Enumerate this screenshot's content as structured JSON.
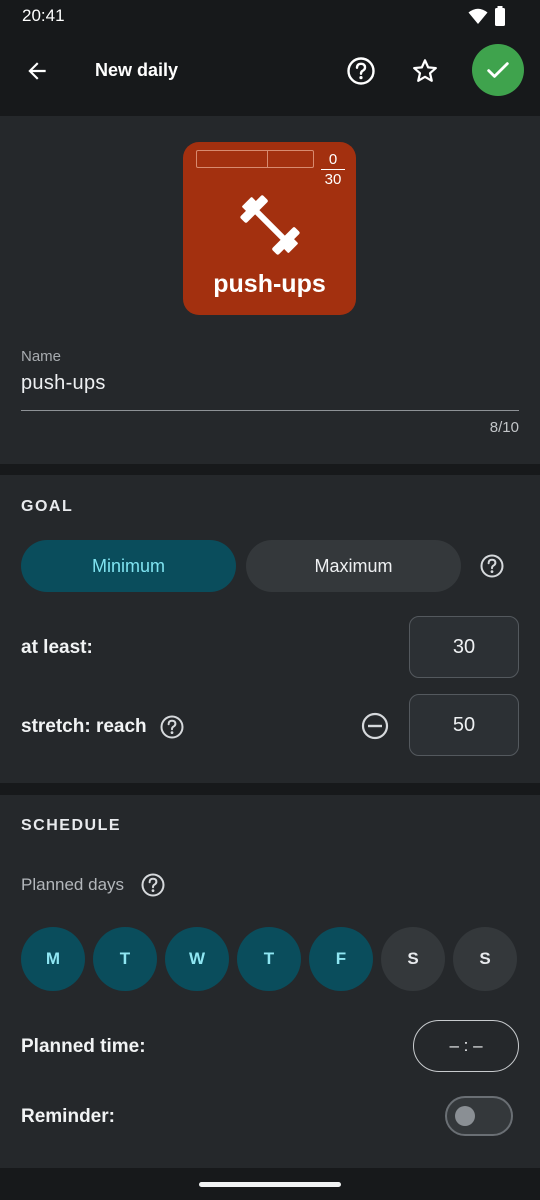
{
  "status": {
    "time": "20:41"
  },
  "appbar": {
    "title": "New daily"
  },
  "card": {
    "count": "0",
    "total": "30",
    "name": "push-ups",
    "color": "#a3300f"
  },
  "name_field": {
    "label": "Name",
    "value": "push-ups",
    "counter": "8/10"
  },
  "goal": {
    "title": "GOAL",
    "options": [
      "Minimum",
      "Maximum"
    ],
    "selected": "Minimum",
    "at_least_label": "at least:",
    "at_least_value": "30",
    "stretch_label": "stretch: reach",
    "stretch_value": "50"
  },
  "schedule": {
    "title": "SCHEDULE",
    "planned_days_label": "Planned days",
    "days": [
      {
        "label": "M",
        "selected": true
      },
      {
        "label": "T",
        "selected": true
      },
      {
        "label": "W",
        "selected": true
      },
      {
        "label": "T",
        "selected": true
      },
      {
        "label": "F",
        "selected": true
      },
      {
        "label": "S",
        "selected": false
      },
      {
        "label": "S",
        "selected": false
      }
    ],
    "planned_time_label": "Planned time:",
    "planned_time_value": "– : –",
    "reminder_label": "Reminder:",
    "reminder_on": false
  },
  "colors": {
    "accent": "#0a4d5c",
    "accent_text": "#7fe3f0",
    "confirm": "#3fa34d"
  },
  "icons": [
    "wifi-icon",
    "battery-icon",
    "back-arrow-icon",
    "help-icon",
    "star-icon",
    "check-icon",
    "dumbbell-icon",
    "minus-circle-icon"
  ]
}
